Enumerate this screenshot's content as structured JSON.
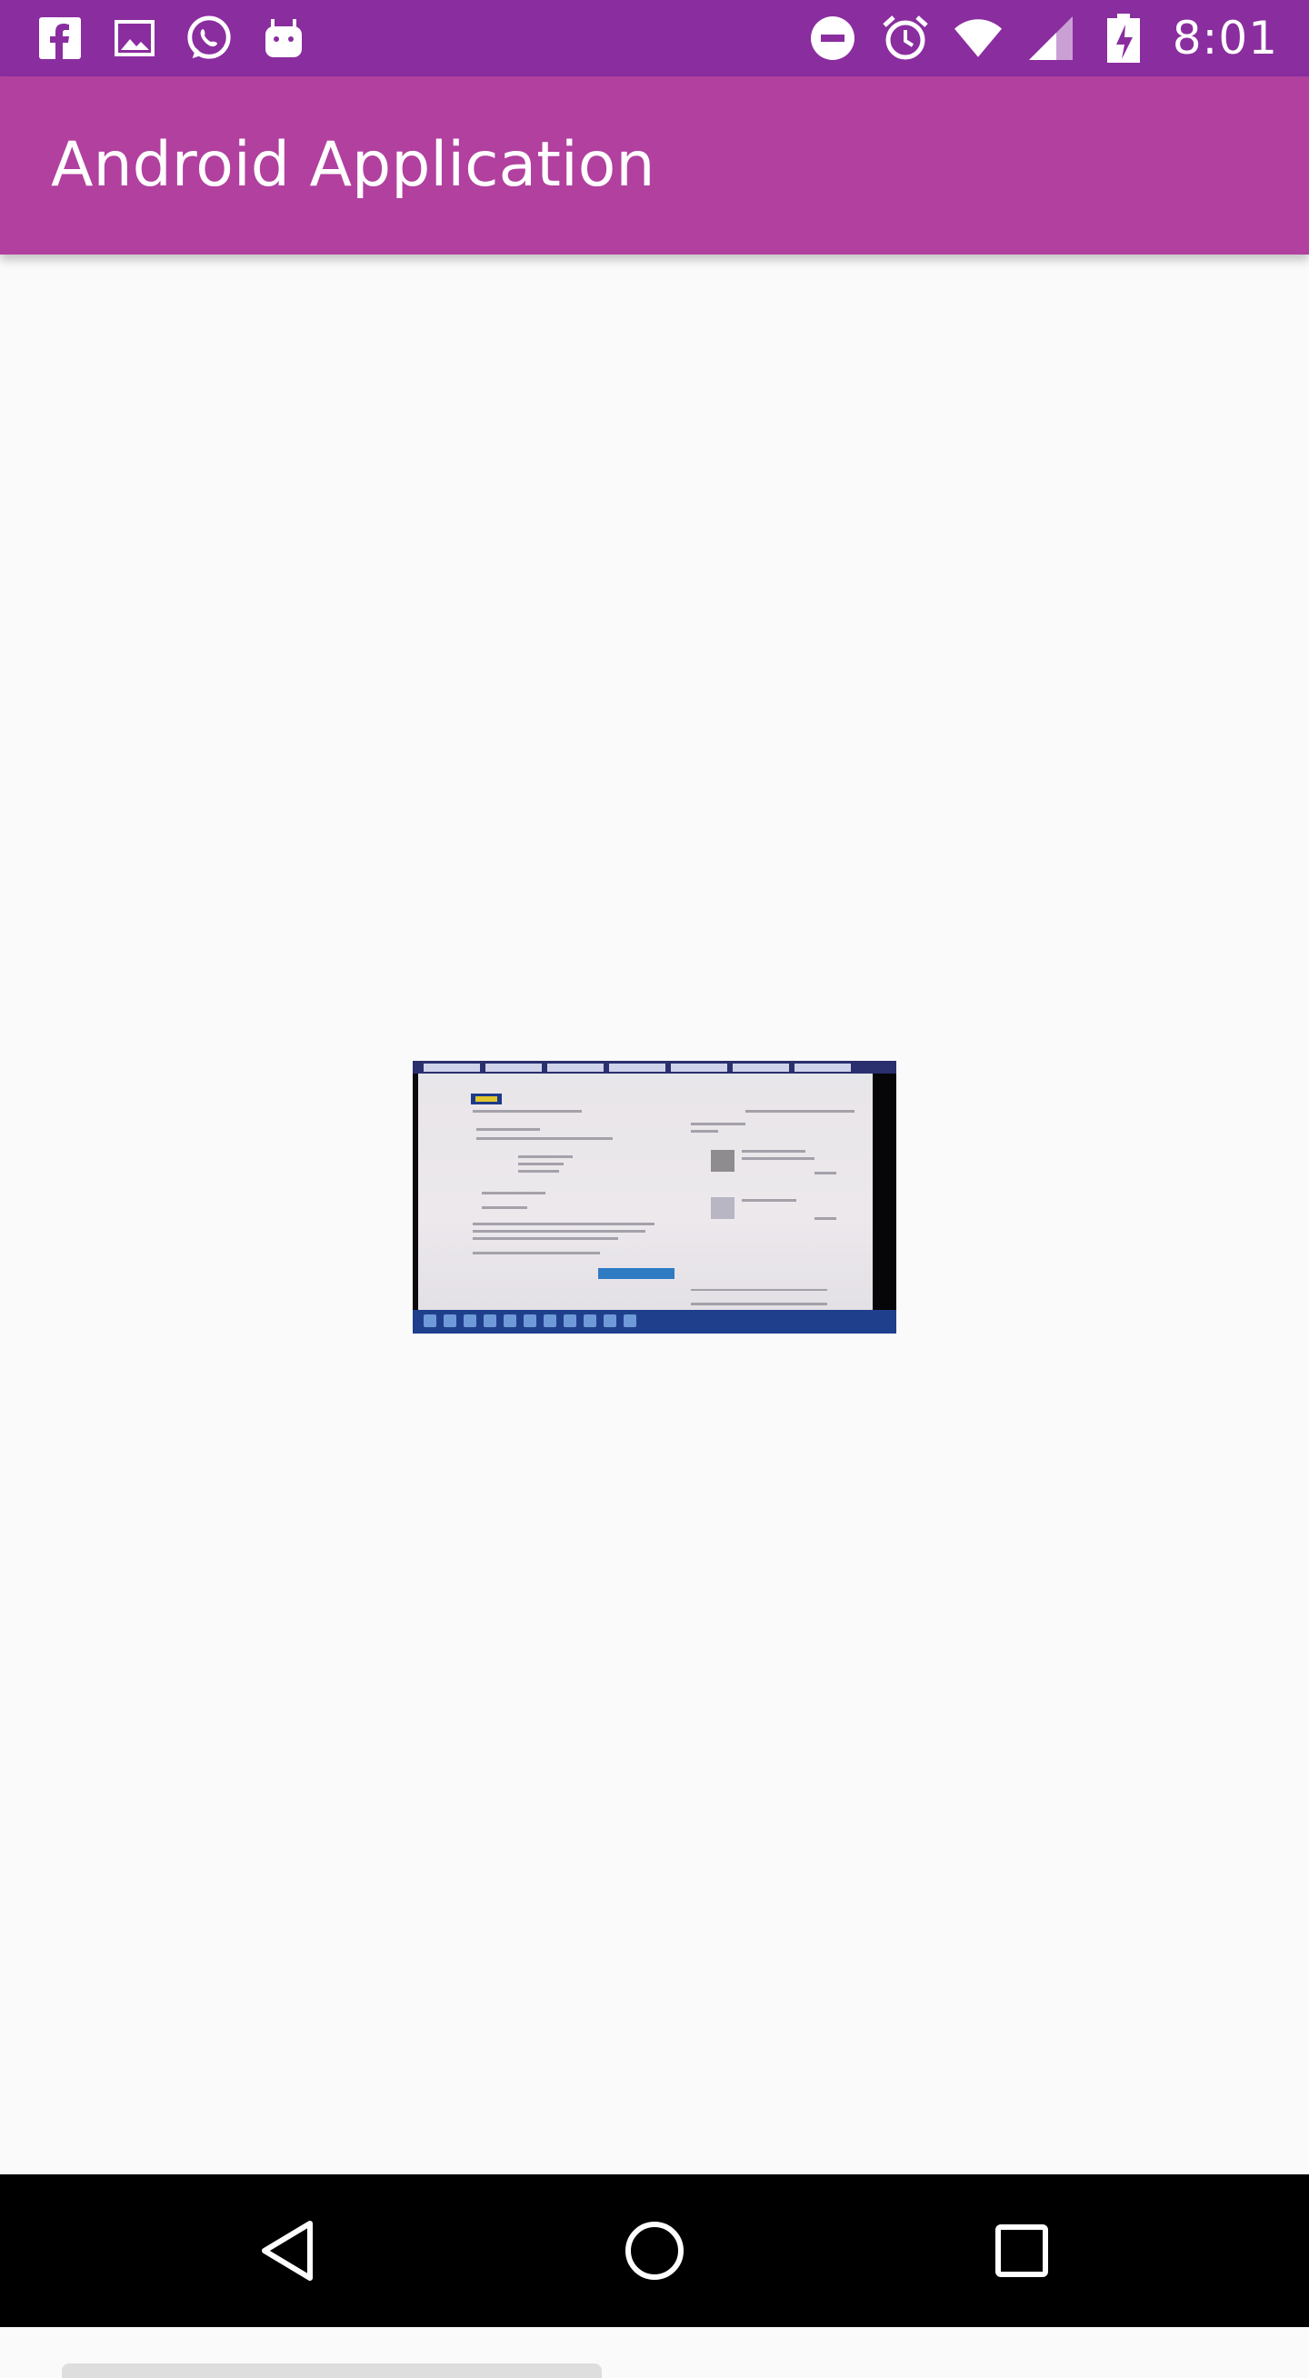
{
  "status_bar": {
    "time": "8:01",
    "left_icons": [
      "facebook-icon",
      "gallery-icon",
      "whatsapp-icon",
      "android-icon"
    ],
    "right_icons": [
      "do-not-disturb-icon",
      "alarm-icon",
      "wifi-icon",
      "cell-signal-icon",
      "battery-charging-icon"
    ]
  },
  "app_bar": {
    "title": "Android Application",
    "color": "#b1409f"
  },
  "content": {
    "image": "screenshot-photo-of-checkout-page"
  },
  "navigation_bar": {
    "buttons": [
      "back-icon",
      "home-icon",
      "recent-apps-icon"
    ]
  },
  "colors": {
    "status_bar": "#8a2d9f",
    "app_bar": "#b1409f",
    "background": "#fafafa"
  }
}
